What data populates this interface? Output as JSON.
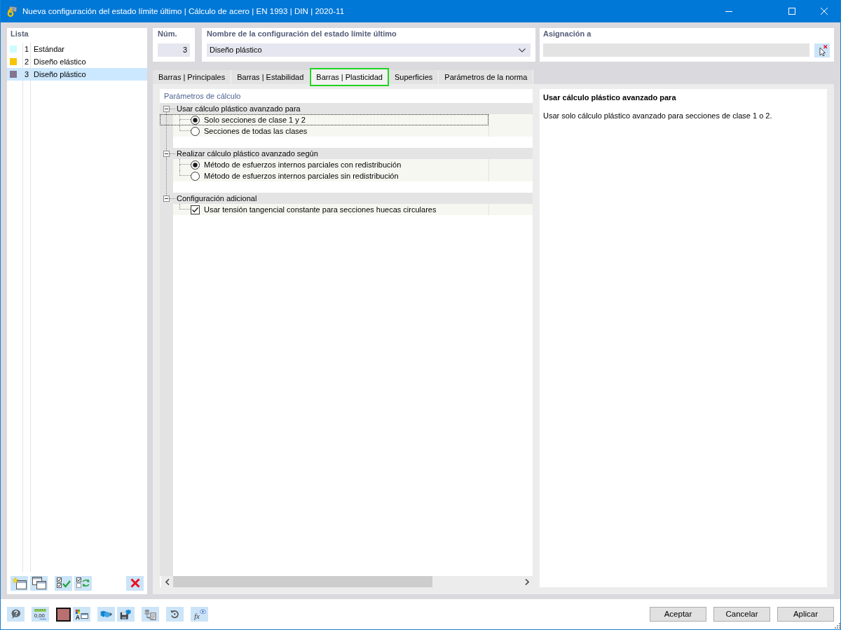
{
  "window": {
    "title": "Nueva configuración del estado límite último | Cálculo de acero | EN 1993 | DIN | 2020-11"
  },
  "list": {
    "title": "Lista",
    "items": [
      {
        "number": "1",
        "name": "Estándar",
        "color": "#ccfcfc",
        "selected": false
      },
      {
        "number": "2",
        "name": "Diseño elástico",
        "color": "#f6c500",
        "selected": false
      },
      {
        "number": "3",
        "name": "Diseño plástico",
        "color": "#847490",
        "selected": true
      }
    ]
  },
  "number_field": {
    "label": "Núm.",
    "value": "3"
  },
  "name_field": {
    "label": "Nombre de la configuración del estado límite último",
    "value": "Diseño plástico"
  },
  "assignment_field": {
    "label": "Asignación a"
  },
  "tabs": [
    {
      "label": "Barras | Principales",
      "selected": false
    },
    {
      "label": "Barras | Estabilidad",
      "selected": false
    },
    {
      "label": "Barras | Plasticidad",
      "selected": true
    },
    {
      "label": "Superficies",
      "selected": false
    },
    {
      "label": "Parámetros de la norma",
      "selected": false
    }
  ],
  "parameters": {
    "title": "Parámetros de cálculo",
    "groups": [
      {
        "label": "Usar cálculo plástico avanzado para",
        "expanded": true,
        "children": [
          {
            "kind": "radio",
            "label": "Solo secciones de clase 1 y 2",
            "checked": true,
            "focused": true
          },
          {
            "kind": "radio",
            "label": "Secciones de todas las clases",
            "checked": false,
            "focused": false
          }
        ]
      },
      {
        "label": "Realizar cálculo plástico avanzado según",
        "expanded": true,
        "children": [
          {
            "kind": "radio",
            "label": "Método de esfuerzos internos parciales con redistribución",
            "checked": true,
            "focused": false
          },
          {
            "kind": "radio",
            "label": "Método de esfuerzos internos parciales sin redistribución",
            "checked": false,
            "focused": false
          }
        ]
      },
      {
        "label": "Configuración adicional",
        "expanded": true,
        "children": [
          {
            "kind": "checkbox",
            "label": "Usar tensión tangencial constante para secciones huecas circulares",
            "checked": true,
            "focused": false
          }
        ]
      }
    ]
  },
  "info": {
    "title": "Usar cálculo plástico avanzado para",
    "text": "Usar solo cálculo plástico avanzado para secciones de clase 1 o 2."
  },
  "bottom_toolbar": [
    {
      "kind": "help"
    },
    {
      "kind": "decimals",
      "text": "0,00"
    },
    {
      "kind": "color"
    },
    {
      "kind": "display",
      "text": "A"
    },
    {
      "kind": "export"
    },
    {
      "kind": "save"
    },
    {
      "kind": "database"
    },
    {
      "kind": "reset"
    },
    {
      "kind": "formula",
      "text": "fx"
    }
  ],
  "buttons": [
    "Aceptar",
    "Cancelar",
    "Aplicar"
  ]
}
